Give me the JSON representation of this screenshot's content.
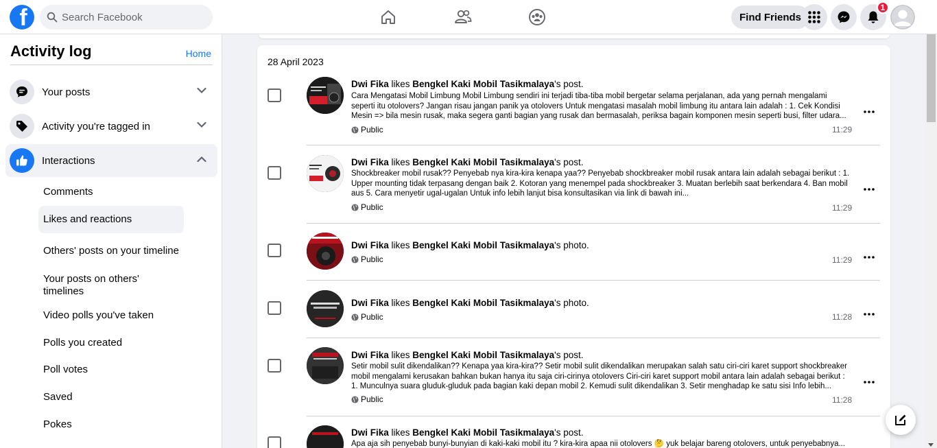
{
  "topbar": {
    "logo": "facebook-logo",
    "search_placeholder": "Search Facebook",
    "nav_icons": [
      "home-icon",
      "friends-icon",
      "groups-icon"
    ],
    "find_friends": "Find Friends",
    "notification_count": "1"
  },
  "sidebar": {
    "title": "Activity log",
    "home_link": "Home",
    "sections": [
      {
        "label": "Your posts",
        "icon": "comment-bubble-icon",
        "expanded": false
      },
      {
        "label": "Activity you're tagged in",
        "icon": "tag-icon",
        "expanded": false
      },
      {
        "label": "Interactions",
        "icon": "thumbs-up-icon",
        "expanded": true
      }
    ],
    "sub_items": [
      "Comments",
      "Likes and reactions",
      "Others' posts on your timeline",
      "Your posts on others' timelines",
      "Video polls you've taken",
      "Polls you created",
      "Poll votes",
      "Saved",
      "Pokes"
    ],
    "active_sub_item": "Likes and reactions"
  },
  "main": {
    "date": "28 April 2023",
    "entries": [
      {
        "actor": "Dwi Fika",
        "action": " likes ",
        "page": "Bengkel Kaki Mobil Tasikmalaya",
        "object": "'s post.",
        "description": "Cara Mengatasi Mobil Limbung Mobil Limbung sendiri ini terjadi tiba-tiba mobil bergetar selama perjalanan, ada yang pernah mengalami seperti itu otolovers? Jangan risau jangan panik ya otolovers Untuk mengatasi masalah mobil limbung itu antara lain adalah : 1. Cek Kondisi Mesin => bila mesin rusak, maka segera ganti bagian yang rusak dan bermasalah, periksa bagain komponen mesin seperti busi, filter udara...",
        "privacy": "Public",
        "time": "11:29"
      },
      {
        "actor": "Dwi Fika",
        "action": " likes ",
        "page": "Bengkel Kaki Mobil Tasikmalaya",
        "object": "'s post.",
        "description": "Shockbreaker mobil rusak?? Penyebab nya kira-kira kenapa yaa?? Penyebab shockbreaker mobil rusak antara lain adalah sebagai berikut : 1. Upper mounting tidak terpasang dengan baik 2. Kotoran yang menempel pada shockbreaker 3. Muatan berlebih saat berkendara 4. Ban mobil aus 5. Cara menyetir ugal-ugalan Untuk info lebih lanjut bisa konsultasikan via link di bawah ini...",
        "privacy": "Public",
        "time": "11:29"
      },
      {
        "actor": "Dwi Fika",
        "action": " likes ",
        "page": "Bengkel Kaki Mobil Tasikmalaya",
        "object": "'s photo.",
        "description": "",
        "privacy": "Public",
        "time": "11:29"
      },
      {
        "actor": "Dwi Fika",
        "action": " likes ",
        "page": "Bengkel Kaki Mobil Tasikmalaya",
        "object": "'s photo.",
        "description": "",
        "privacy": "Public",
        "time": "11:28"
      },
      {
        "actor": "Dwi Fika",
        "action": " likes ",
        "page": "Bengkel Kaki Mobil Tasikmalaya",
        "object": "'s post.",
        "description": "Setir mobil sulit dikendalikan?? Kenapa yaa kira-kira?? Setir mobil sulit dikendalikan merupakan salah satu ciri-ciri karet support shockbreaker mobil mengalami kerusakan bahkan bukan hanya itu saja ciri-cirinya otolovers Ciri-ciri karet support mobil antara lain adalah sebagai berikut : 1. Munculnya suara gluduk-gluduk pada bagian kaki depan mobil 2. Kemudi sulit dikendalikan 3. Setir menghadap ke satu sisi Info lebih...",
        "privacy": "Public",
        "time": "11:28"
      },
      {
        "actor": "Dwi Fika",
        "action": " likes ",
        "page": "Bengkel Kaki Mobil Tasikmalaya",
        "object": "'s post.",
        "description": "Apa aja sih penyebab bunyi-bunyian di kaki-kaki mobil itu ? kira-kira apaa nii otolovers 🤔 yuk belajar bareng otolovers, untuk penyebabnya...",
        "privacy": "",
        "time": ""
      }
    ]
  },
  "colors": {
    "brand": "#1877f2",
    "badge": "#e41e3f",
    "background": "#f0f2f5"
  }
}
